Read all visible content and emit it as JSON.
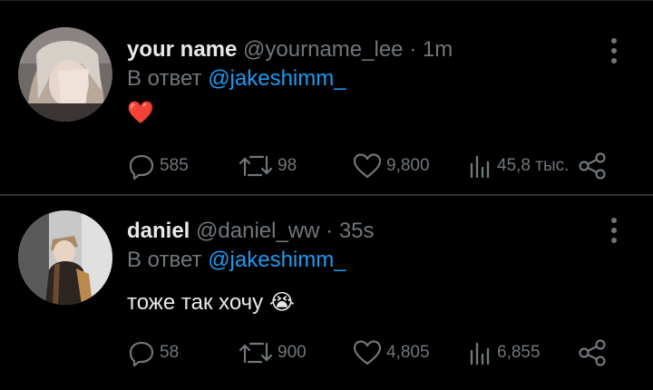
{
  "tweets": [
    {
      "name": "your name",
      "handle": "@yourname_lee",
      "separator": "·",
      "time": "1m",
      "reply_prefix": "В ответ",
      "reply_to": "@jakeshimm_",
      "body": "❤️",
      "counts": {
        "replies": "585",
        "retweets": "98",
        "likes": "9,800",
        "views": "45,8 тыс."
      }
    },
    {
      "name": "daniel",
      "handle": "@daniel_ww",
      "separator": "·",
      "time": "35s",
      "reply_prefix": "В ответ",
      "reply_to": "@jakeshimm_",
      "body": "тоже так хочу 😭",
      "counts": {
        "replies": "58",
        "retweets": "900",
        "likes": "4,805",
        "views": "6,855"
      }
    }
  ],
  "colors": {
    "background": "#000000",
    "text": "#e7e9ea",
    "muted": "#71767b",
    "accent": "#1d9bf0",
    "divider": "#2f3336"
  },
  "icons": [
    "reply-icon",
    "retweet-icon",
    "like-icon",
    "views-icon",
    "share-icon",
    "more-icon"
  ]
}
